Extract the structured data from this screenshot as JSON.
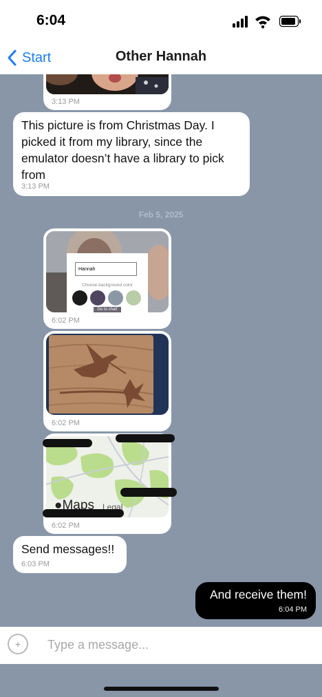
{
  "status_bar": {
    "time": "6:04"
  },
  "nav": {
    "back_label": "Start",
    "title": "Other Hannah"
  },
  "messages": [
    {
      "time": "3:13 PM"
    },
    {
      "text": "This picture is from Christmas Day. I picked it from my library, since the emulator doesn’t have a library to pick from",
      "time": "3:13 PM"
    },
    {
      "date_separator": "Feb 5, 2025"
    },
    {
      "time": "6:02 PM",
      "embedded_form": {
        "name_value": "Hannah",
        "prompt": "Choose background color",
        "swatches": [
          "#1b1b1b",
          "#4f4560",
          "#8a98a6",
          "#b9cca8"
        ],
        "button_label": "Go to chat!"
      }
    },
    {
      "time": "6:02 PM"
    },
    {
      "time": "6:02 PM",
      "map_brand": "Maps",
      "map_legal": "Legal"
    },
    {
      "text": "Send messages!!",
      "time": "6:03 PM"
    }
  ],
  "sent_message": {
    "text": "And receive them!",
    "time": "6:04 PM"
  },
  "composer": {
    "placeholder": "Type a message..."
  },
  "colors": {
    "chat_background": "#8896a8",
    "accent": "#1a7cf5",
    "sent_bubble": "#000000"
  }
}
